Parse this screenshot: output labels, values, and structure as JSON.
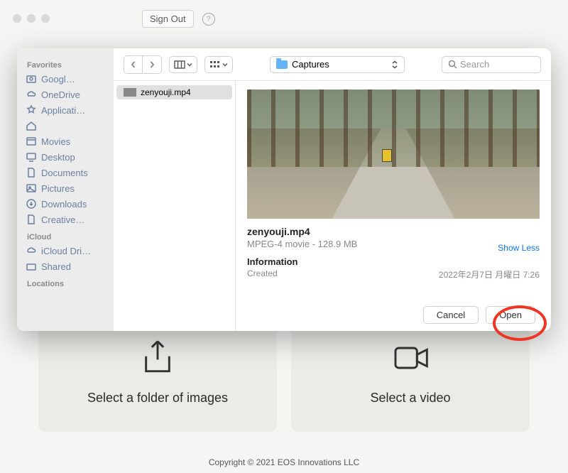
{
  "top": {
    "sign_out": "Sign Out"
  },
  "cards": {
    "folder": "Select a folder of images",
    "video": "Select a video"
  },
  "footer": "Copyright © 2021 EOS Innovations LLC",
  "dialog": {
    "folder_name": "Captures",
    "search_placeholder": "Search",
    "sidebar": {
      "favorites_header": "Favorites",
      "favorites": [
        "Googl…",
        "OneDrive",
        "Applicati…",
        "",
        "Movies",
        "Desktop",
        "Documents",
        "Pictures",
        "Downloads",
        "Creative…"
      ],
      "icloud_header": "iCloud",
      "icloud": [
        "iCloud Dri…",
        "Shared"
      ],
      "locations_header": "Locations"
    },
    "file_name": "zenyouji.mp4",
    "preview": {
      "title": "zenyouji.mp4",
      "subtitle": "MPEG-4 movie - 128.9 MB",
      "information": "Information",
      "created_label": "Created",
      "created_value": "2022年2月7日 月曜日 7:26",
      "show_less": "Show Less"
    },
    "buttons": {
      "cancel": "Cancel",
      "open": "Open"
    }
  }
}
